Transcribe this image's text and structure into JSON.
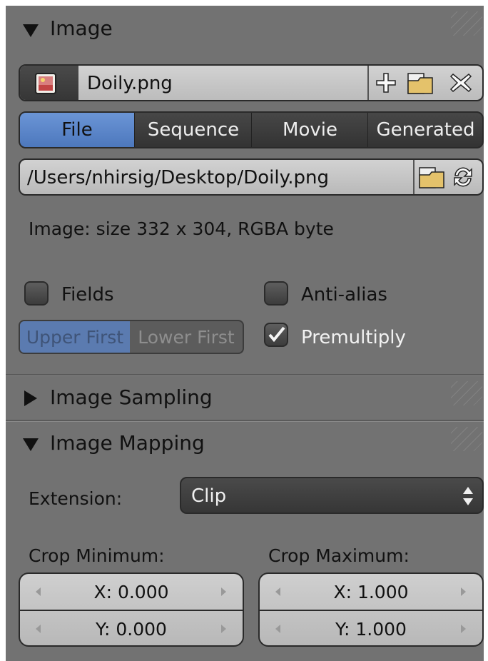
{
  "image_panel": {
    "title": "Image",
    "datablock": {
      "name": "Doily.png"
    },
    "source_tabs": [
      {
        "label": "File",
        "active": true
      },
      {
        "label": "Sequence",
        "active": false
      },
      {
        "label": "Movie",
        "active": false
      },
      {
        "label": "Generated",
        "active": false
      }
    ],
    "filepath": "/Users/nhirsig/Desktop/Doily.png",
    "info": "Image: size 332 x 304, RGBA byte",
    "fields": {
      "label": "Fields",
      "checked": false
    },
    "field_order": {
      "upper": "Upper First",
      "lower": "Lower First",
      "selected": "upper"
    },
    "anti_alias": {
      "label": "Anti-alias",
      "checked": false
    },
    "premultiply": {
      "label": "Premultiply",
      "checked": true
    }
  },
  "sampling_panel": {
    "title": "Image Sampling",
    "collapsed": true
  },
  "mapping_panel": {
    "title": "Image Mapping",
    "extension_label": "Extension:",
    "extension_value": "Clip",
    "crop_min": {
      "label": "Crop Minimum:",
      "x": "X: 0.000",
      "y": "Y: 0.000"
    },
    "crop_max": {
      "label": "Crop Maximum:",
      "x": "X: 1.000",
      "y": "Y: 1.000"
    }
  },
  "colors": {
    "panel_bg": "#727272",
    "active_tab": "#5680c2",
    "dark_button": "#3e3e3e",
    "field": "#c4c4c4"
  },
  "icons": [
    "image-icon",
    "plus-icon",
    "folder-icon",
    "close-icon",
    "reload-icon",
    "checkmark-icon",
    "updown-arrows-icon"
  ]
}
